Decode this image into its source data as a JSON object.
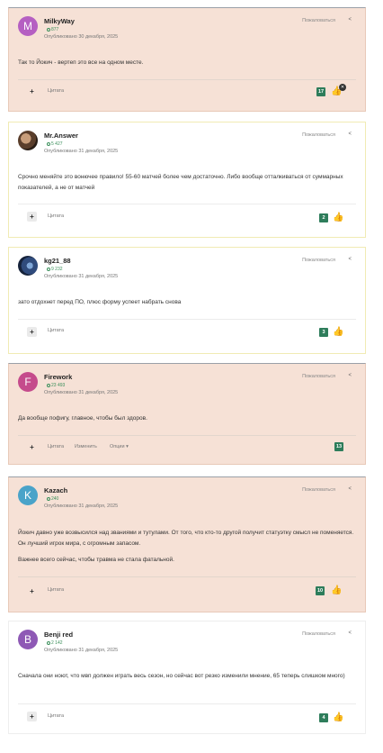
{
  "labels": {
    "report": "Пожаловаться",
    "quote": "Цитата",
    "edit": "Изменить",
    "options": "Опции",
    "plus": "+",
    "share_icon": "share-icon"
  },
  "posts": [
    {
      "author": "MilkyWay",
      "avatar_letter": "M",
      "avatar_color": "#b55fc2",
      "reputation": "877",
      "date": "Опубликовано 30 декабря, 2025",
      "text": [
        "Так то Йокич - вертеп это все на одном месте."
      ],
      "likes": "17"
    },
    {
      "author": "Mr.Answer",
      "avatar_letter": "",
      "reputation": "5 427",
      "date": "Опубликовано 31 декабря, 2025",
      "text": [
        "Срочно меняйте это вонючее правило! 55-60 матчей более чем достаточно. Либо вообще отталкиваться от суммарных показателей, а не от матчей"
      ],
      "likes": "2"
    },
    {
      "author": "kg21_88",
      "avatar_letter": "",
      "reputation": "9 232",
      "date": "Опубликовано 31 декабря, 2025",
      "text": [
        "зато отдохнет перед ПО, плюс форму успеет набрать снова"
      ],
      "likes": "3"
    },
    {
      "author": "Firework",
      "avatar_letter": "F",
      "avatar_color": "#c54b8c",
      "reputation": "23 493",
      "date": "Опубликовано 31 декабря, 2025",
      "text": [
        "Да вообще пофигу, главное, чтобы был здоров."
      ],
      "likes": "13"
    },
    {
      "author": "Kazach",
      "avatar_letter": "K",
      "avatar_color": "#4aa3c9",
      "reputation": "240",
      "date": "Опубликовано 31 декабря, 2025",
      "text": [
        "Йокич давно уже возвысился над званиями и тутулами. От того, что кто-то другой получит статуэтку смысл не поменяется. Он лучший игрок мира, с огромным запасом.",
        "Важнее всего сейчас, чтобы травма не стала фатальной."
      ],
      "likes": "10"
    },
    {
      "author": "Benji red",
      "avatar_letter": "B",
      "avatar_color": "#8e59b5",
      "reputation": "2 142",
      "date": "Опубликовано 31 декабря, 2025",
      "text": [
        "Сначала они ноют, что мвп должен играть весь сезон, но сейчас вот резко изменили мнение, 65 теперь слишком много)"
      ],
      "likes": "4"
    }
  ]
}
